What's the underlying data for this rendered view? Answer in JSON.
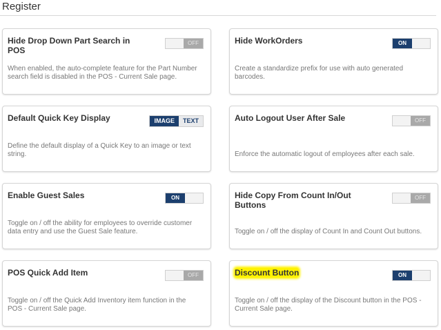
{
  "section": {
    "title": "Register"
  },
  "colors": {
    "accent": "#1c3f6e",
    "off": "#a9a9a9",
    "highlight": "#fff200"
  },
  "settings": [
    {
      "title": "Hide Drop Down Part Search in POS",
      "description": "When enabled, the auto-complete feature for the Part Number search field is disabled in the POS - Current Sale page.",
      "state": "OFF"
    },
    {
      "title": "Hide WorkOrders",
      "description": "Create a standardize prefix for use with auto generated barcodes.",
      "state": "ON"
    },
    {
      "title": "Default Quick Key Display",
      "description": "Define the default display of a Quick Key to an image or text string.",
      "options": [
        "IMAGE",
        "TEXT"
      ],
      "selected": "IMAGE"
    },
    {
      "title": "Auto Logout User After Sale",
      "description": "Enforce the automatic logout of employees after each sale.",
      "state": "OFF"
    },
    {
      "title": "Enable Guest Sales",
      "description": "Toggle on / off the ability for employees to override customer data entry and use the Guest Sale feature.",
      "state": "ON"
    },
    {
      "title": "Hide Copy From Count In/Out Buttons",
      "description": "Toggle on / off the display of Count In and Count Out buttons.",
      "state": "OFF"
    },
    {
      "title": "POS Quick Add Item",
      "description": "Toggle on / off the Quick Add Inventory item function in the POS - Current Sale page.",
      "state": "OFF"
    },
    {
      "title": "Discount Button",
      "description": "Toggle on / off the display of the Discount button in the POS - Current Sale page.",
      "state": "ON",
      "highlighted": true
    }
  ]
}
